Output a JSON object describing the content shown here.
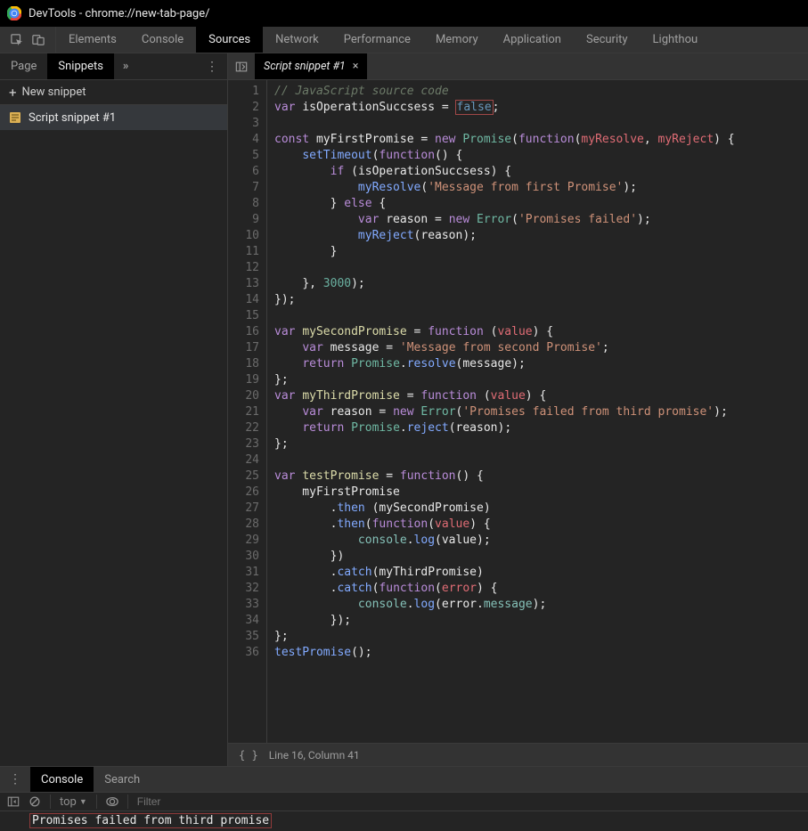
{
  "window": {
    "title": "DevTools - chrome://new-tab-page/"
  },
  "main_tabs": [
    "Elements",
    "Console",
    "Sources",
    "Network",
    "Performance",
    "Memory",
    "Application",
    "Security",
    "Lighthou"
  ],
  "main_active": "Sources",
  "sub_tabs": {
    "page": "Page",
    "snippets": "Snippets",
    "overflow": "»"
  },
  "new_snippet_label": "New snippet",
  "snippet_name": "Script snippet #1",
  "editor_tab_name": "Script snippet #1",
  "status": {
    "cursor": "Line 16, Column 41"
  },
  "drawer": {
    "tabs": {
      "console": "Console",
      "search": "Search"
    },
    "context": "top",
    "filter_placeholder": "Filter",
    "output": "Promises failed from third promise"
  },
  "code": {
    "1": {
      "t": "comment",
      "s": "// JavaScript source code"
    },
    "2": [
      {
        "t": "kw",
        "s": "var "
      },
      {
        "t": "ident",
        "s": "isOperationSuccsess "
      },
      {
        "t": "op",
        "s": "= "
      },
      {
        "t": "bool",
        "s": "false",
        "hl": true
      },
      {
        "t": "op",
        "s": ";"
      }
    ],
    "3": "",
    "4": [
      {
        "t": "kw",
        "s": "const "
      },
      {
        "t": "ident",
        "s": "myFirstPromise "
      },
      {
        "t": "op",
        "s": "= "
      },
      {
        "t": "kw",
        "s": "new "
      },
      {
        "t": "type",
        "s": "Promise"
      },
      {
        "t": "paren",
        "s": "("
      },
      {
        "t": "kw",
        "s": "function"
      },
      {
        "t": "paren",
        "s": "("
      },
      {
        "t": "arg",
        "s": "myResolve"
      },
      {
        "t": "op",
        "s": ", "
      },
      {
        "t": "arg",
        "s": "myReject"
      },
      {
        "t": "paren",
        "s": ") {"
      }
    ],
    "5": [
      {
        "t": "ident",
        "s": "    "
      },
      {
        "t": "builtin",
        "s": "setTimeout"
      },
      {
        "t": "paren",
        "s": "("
      },
      {
        "t": "kw",
        "s": "function"
      },
      {
        "t": "paren",
        "s": "() {"
      }
    ],
    "6": [
      {
        "t": "ident",
        "s": "        "
      },
      {
        "t": "kw",
        "s": "if "
      },
      {
        "t": "paren",
        "s": "("
      },
      {
        "t": "ident",
        "s": "isOperationSuccsess"
      },
      {
        "t": "paren",
        "s": ") {"
      }
    ],
    "7": [
      {
        "t": "ident",
        "s": "            "
      },
      {
        "t": "builtin",
        "s": "myResolve"
      },
      {
        "t": "paren",
        "s": "("
      },
      {
        "t": "str",
        "s": "'Message from first Promise'"
      },
      {
        "t": "paren",
        "s": ");"
      }
    ],
    "8": [
      {
        "t": "ident",
        "s": "        "
      },
      {
        "t": "paren",
        "s": "} "
      },
      {
        "t": "kw",
        "s": "else"
      },
      {
        "t": "paren",
        "s": " {"
      }
    ],
    "9": [
      {
        "t": "ident",
        "s": "            "
      },
      {
        "t": "kw",
        "s": "var "
      },
      {
        "t": "ident",
        "s": "reason "
      },
      {
        "t": "op",
        "s": "= "
      },
      {
        "t": "kw",
        "s": "new "
      },
      {
        "t": "type",
        "s": "Error"
      },
      {
        "t": "paren",
        "s": "("
      },
      {
        "t": "str",
        "s": "'Promises failed'"
      },
      {
        "t": "paren",
        "s": ");"
      }
    ],
    "10": [
      {
        "t": "ident",
        "s": "            "
      },
      {
        "t": "builtin",
        "s": "myReject"
      },
      {
        "t": "paren",
        "s": "("
      },
      {
        "t": "ident",
        "s": "reason"
      },
      {
        "t": "paren",
        "s": ");"
      }
    ],
    "11": [
      {
        "t": "ident",
        "s": "        "
      },
      {
        "t": "paren",
        "s": "}"
      }
    ],
    "12": "",
    "13": [
      {
        "t": "ident",
        "s": "    "
      },
      {
        "t": "paren",
        "s": "}, "
      },
      {
        "t": "num",
        "s": "3000"
      },
      {
        "t": "paren",
        "s": ");"
      }
    ],
    "14": [
      {
        "t": "paren",
        "s": "});"
      }
    ],
    "15": "",
    "16": [
      {
        "t": "kw",
        "s": "var "
      },
      {
        "t": "yellow",
        "s": "mySecondPromise "
      },
      {
        "t": "op",
        "s": "= "
      },
      {
        "t": "kw",
        "s": "function "
      },
      {
        "t": "paren",
        "s": "("
      },
      {
        "t": "arg",
        "s": "value"
      },
      {
        "t": "paren",
        "s": ") {"
      }
    ],
    "17": [
      {
        "t": "ident",
        "s": "    "
      },
      {
        "t": "kw",
        "s": "var "
      },
      {
        "t": "ident",
        "s": "message "
      },
      {
        "t": "op",
        "s": "= "
      },
      {
        "t": "str",
        "s": "'Message from second Promise'"
      },
      {
        "t": "op",
        "s": ";"
      }
    ],
    "18": [
      {
        "t": "ident",
        "s": "    "
      },
      {
        "t": "kw",
        "s": "return "
      },
      {
        "t": "type",
        "s": "Promise"
      },
      {
        "t": "op",
        "s": "."
      },
      {
        "t": "builtin",
        "s": "resolve"
      },
      {
        "t": "paren",
        "s": "("
      },
      {
        "t": "ident",
        "s": "message"
      },
      {
        "t": "paren",
        "s": ");"
      }
    ],
    "19": [
      {
        "t": "paren",
        "s": "};"
      }
    ],
    "20": [
      {
        "t": "kw",
        "s": "var "
      },
      {
        "t": "yellow",
        "s": "myThirdPromise "
      },
      {
        "t": "op",
        "s": "= "
      },
      {
        "t": "kw",
        "s": "function "
      },
      {
        "t": "paren",
        "s": "("
      },
      {
        "t": "arg",
        "s": "value"
      },
      {
        "t": "paren",
        "s": ") {"
      }
    ],
    "21": [
      {
        "t": "ident",
        "s": "    "
      },
      {
        "t": "kw",
        "s": "var "
      },
      {
        "t": "ident",
        "s": "reason "
      },
      {
        "t": "op",
        "s": "= "
      },
      {
        "t": "kw",
        "s": "new "
      },
      {
        "t": "type",
        "s": "Error"
      },
      {
        "t": "paren",
        "s": "("
      },
      {
        "t": "str",
        "s": "'Promises failed from third promise'"
      },
      {
        "t": "paren",
        "s": ");"
      }
    ],
    "22": [
      {
        "t": "ident",
        "s": "    "
      },
      {
        "t": "kw",
        "s": "return "
      },
      {
        "t": "type",
        "s": "Promise"
      },
      {
        "t": "op",
        "s": "."
      },
      {
        "t": "builtin",
        "s": "reject"
      },
      {
        "t": "paren",
        "s": "("
      },
      {
        "t": "ident",
        "s": "reason"
      },
      {
        "t": "paren",
        "s": ");"
      }
    ],
    "23": [
      {
        "t": "paren",
        "s": "};"
      }
    ],
    "24": "",
    "25": [
      {
        "t": "kw",
        "s": "var "
      },
      {
        "t": "yellow",
        "s": "testPromise "
      },
      {
        "t": "op",
        "s": "= "
      },
      {
        "t": "kw",
        "s": "function"
      },
      {
        "t": "paren",
        "s": "() {"
      }
    ],
    "26": [
      {
        "t": "ident",
        "s": "    myFirstPromise"
      }
    ],
    "27": [
      {
        "t": "ident",
        "s": "        ."
      },
      {
        "t": "builtin",
        "s": "then "
      },
      {
        "t": "paren",
        "s": "("
      },
      {
        "t": "ident",
        "s": "mySecondPromise"
      },
      {
        "t": "paren",
        "s": ")"
      }
    ],
    "28": [
      {
        "t": "ident",
        "s": "        ."
      },
      {
        "t": "builtin",
        "s": "then"
      },
      {
        "t": "paren",
        "s": "("
      },
      {
        "t": "kw",
        "s": "function"
      },
      {
        "t": "paren",
        "s": "("
      },
      {
        "t": "arg",
        "s": "value"
      },
      {
        "t": "paren",
        "s": ") {"
      }
    ],
    "29": [
      {
        "t": "ident",
        "s": "            "
      },
      {
        "t": "prop",
        "s": "console"
      },
      {
        "t": "op",
        "s": "."
      },
      {
        "t": "builtin",
        "s": "log"
      },
      {
        "t": "paren",
        "s": "("
      },
      {
        "t": "ident",
        "s": "value"
      },
      {
        "t": "paren",
        "s": ");"
      }
    ],
    "30": [
      {
        "t": "ident",
        "s": "        "
      },
      {
        "t": "paren",
        "s": "})"
      }
    ],
    "31": [
      {
        "t": "ident",
        "s": "        ."
      },
      {
        "t": "builtin",
        "s": "catch"
      },
      {
        "t": "paren",
        "s": "("
      },
      {
        "t": "ident",
        "s": "myThirdPromise"
      },
      {
        "t": "paren",
        "s": ")"
      }
    ],
    "32": [
      {
        "t": "ident",
        "s": "        ."
      },
      {
        "t": "builtin",
        "s": "catch"
      },
      {
        "t": "paren",
        "s": "("
      },
      {
        "t": "kw",
        "s": "function"
      },
      {
        "t": "paren",
        "s": "("
      },
      {
        "t": "arg",
        "s": "error"
      },
      {
        "t": "paren",
        "s": ") {"
      }
    ],
    "33": [
      {
        "t": "ident",
        "s": "            "
      },
      {
        "t": "prop",
        "s": "console"
      },
      {
        "t": "op",
        "s": "."
      },
      {
        "t": "builtin",
        "s": "log"
      },
      {
        "t": "paren",
        "s": "("
      },
      {
        "t": "ident",
        "s": "error"
      },
      {
        "t": "op",
        "s": "."
      },
      {
        "t": "prop",
        "s": "message"
      },
      {
        "t": "paren",
        "s": ");"
      }
    ],
    "34": [
      {
        "t": "ident",
        "s": "        "
      },
      {
        "t": "paren",
        "s": "});"
      }
    ],
    "35": [
      {
        "t": "paren",
        "s": "};"
      }
    ],
    "36": [
      {
        "t": "builtin",
        "s": "testPromise"
      },
      {
        "t": "paren",
        "s": "();"
      }
    ]
  },
  "line_count": 36
}
